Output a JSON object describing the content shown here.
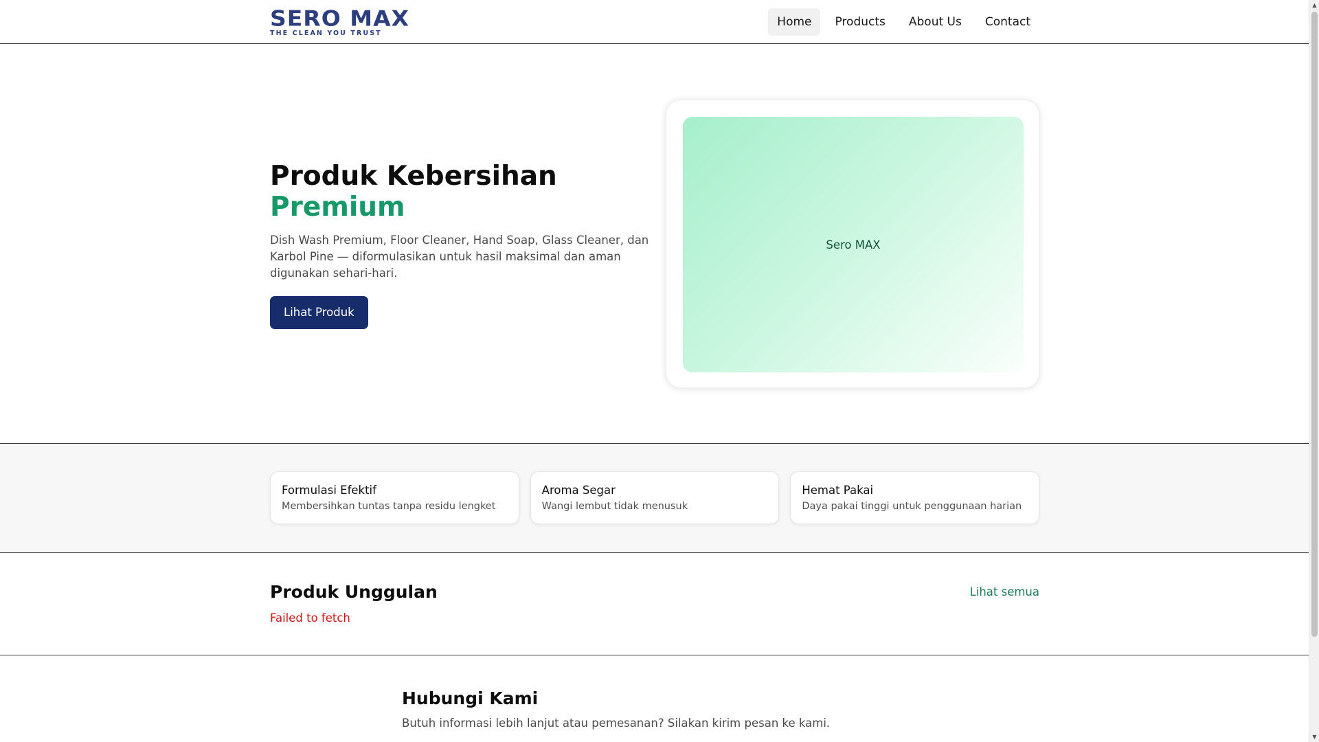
{
  "brand": {
    "name": "SERO MAX",
    "tagline": "THE CLEAN YOU TRUST",
    "color": "#2c3e7d"
  },
  "nav": {
    "items": [
      {
        "label": "Home",
        "active": true
      },
      {
        "label": "Products",
        "active": false
      },
      {
        "label": "About Us",
        "active": false
      },
      {
        "label": "Contact",
        "active": false
      }
    ]
  },
  "hero": {
    "title": "Produk Kebersihan",
    "title_accent": "Premium",
    "accent_color": "#179868",
    "description": "Dish Wash Premium, Floor Cleaner, Hand Soap, Glass Cleaner, dan Karbol Pine — diformulasikan untuk hasil maksimal dan aman digunakan sehari-hari.",
    "cta_label": "Lihat Produk",
    "media_label": "Sero MAX"
  },
  "features": [
    {
      "title": "Formulasi Efektif",
      "text": "Membersihkan tuntas tanpa residu lengket"
    },
    {
      "title": "Aroma Segar",
      "text": "Wangi lembut tidak menusuk"
    },
    {
      "title": "Hemat Pakai",
      "text": "Daya pakai tinggi untuk penggunaan harian"
    }
  ],
  "featured": {
    "title": "Produk Unggulan",
    "link_label": "Lihat semua",
    "error": "Failed to fetch"
  },
  "contact": {
    "title": "Hubungi Kami",
    "text": "Butuh informasi lebih lanjut atau pemesanan? Silakan kirim pesan ke kami."
  },
  "icons": {
    "scroll_up": "scroll-up-arrow-icon",
    "scroll_down": "scroll-down-arrow-icon"
  }
}
